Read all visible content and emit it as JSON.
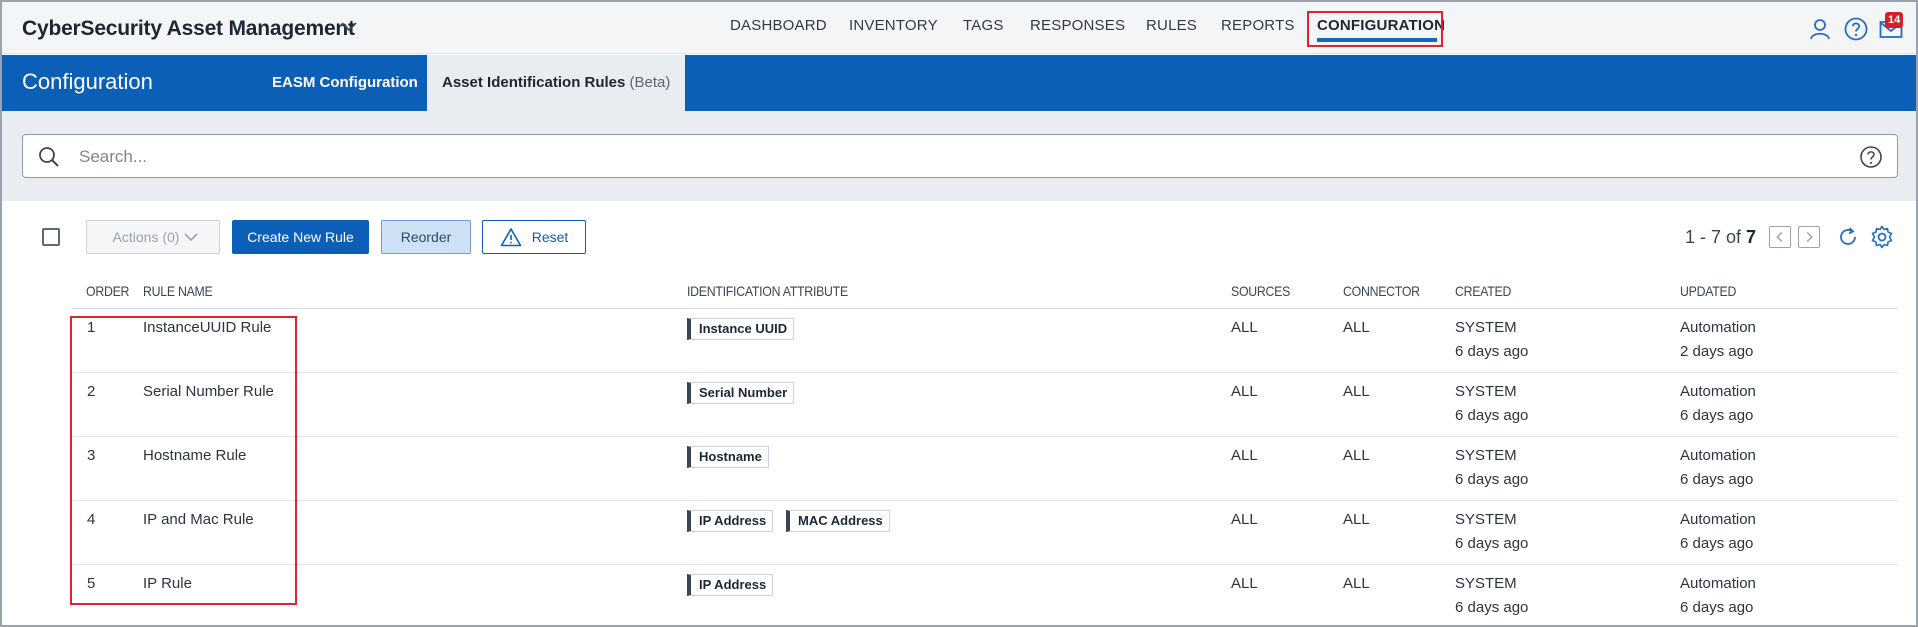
{
  "app": {
    "title": "CyberSecurity Asset Management"
  },
  "nav": {
    "items": [
      {
        "label": "DASHBOARD"
      },
      {
        "label": "INVENTORY"
      },
      {
        "label": "TAGS"
      },
      {
        "label": "RESPONSES"
      },
      {
        "label": "RULES"
      },
      {
        "label": "REPORTS"
      },
      {
        "label": "CONFIGURATION",
        "active": true
      }
    ],
    "notification_count": "14"
  },
  "header": {
    "page_title": "Configuration",
    "tabs": [
      {
        "label": "EASM Configuration"
      },
      {
        "label": "Asset Identification Rules",
        "suffix": "(Beta)",
        "active": true
      }
    ]
  },
  "search": {
    "placeholder": "Search..."
  },
  "toolbar": {
    "actions_label": "Actions (0)",
    "create_label": "Create New Rule",
    "reorder_label": "Reorder",
    "reset_label": "Reset"
  },
  "pager": {
    "range": "1 - 7 of",
    "total": "7"
  },
  "table": {
    "columns": [
      "ORDER",
      "RULE NAME",
      "IDENTIFICATION ATTRIBUTE",
      "SOURCES",
      "CONNECTOR",
      "CREATED",
      "UPDATED"
    ],
    "rows": [
      {
        "order": "1",
        "name": "InstanceUUID Rule",
        "attributes": [
          "Instance UUID"
        ],
        "sources": "ALL",
        "connector": "ALL",
        "created_by": "SYSTEM",
        "created_when": "6 days ago",
        "updated_by": "Automation",
        "updated_when": "2 days ago"
      },
      {
        "order": "2",
        "name": "Serial Number Rule",
        "attributes": [
          "Serial Number"
        ],
        "sources": "ALL",
        "connector": "ALL",
        "created_by": "SYSTEM",
        "created_when": "6 days ago",
        "updated_by": "Automation",
        "updated_when": "6 days ago"
      },
      {
        "order": "3",
        "name": "Hostname Rule",
        "attributes": [
          "Hostname"
        ],
        "sources": "ALL",
        "connector": "ALL",
        "created_by": "SYSTEM",
        "created_when": "6 days ago",
        "updated_by": "Automation",
        "updated_when": "6 days ago"
      },
      {
        "order": "4",
        "name": "IP and Mac Rule",
        "attributes": [
          "IP Address",
          "MAC Address"
        ],
        "sources": "ALL",
        "connector": "ALL",
        "created_by": "SYSTEM",
        "created_when": "6 days ago",
        "updated_by": "Automation",
        "updated_when": "6 days ago"
      },
      {
        "order": "5",
        "name": "IP Rule",
        "attributes": [
          "IP Address"
        ],
        "sources": "ALL",
        "connector": "ALL",
        "created_by": "SYSTEM",
        "created_when": "6 days ago",
        "updated_by": "Automation",
        "updated_when": "6 days ago"
      }
    ]
  },
  "colors": {
    "brand_blue": "#0c5fb7",
    "highlight_red": "#e0242f",
    "badge_red": "#d61f28"
  },
  "icons": [
    "chevron-down-icon",
    "user-icon",
    "help-icon",
    "mail-icon",
    "search-icon",
    "warning-icon",
    "refresh-icon",
    "gear-icon"
  ]
}
